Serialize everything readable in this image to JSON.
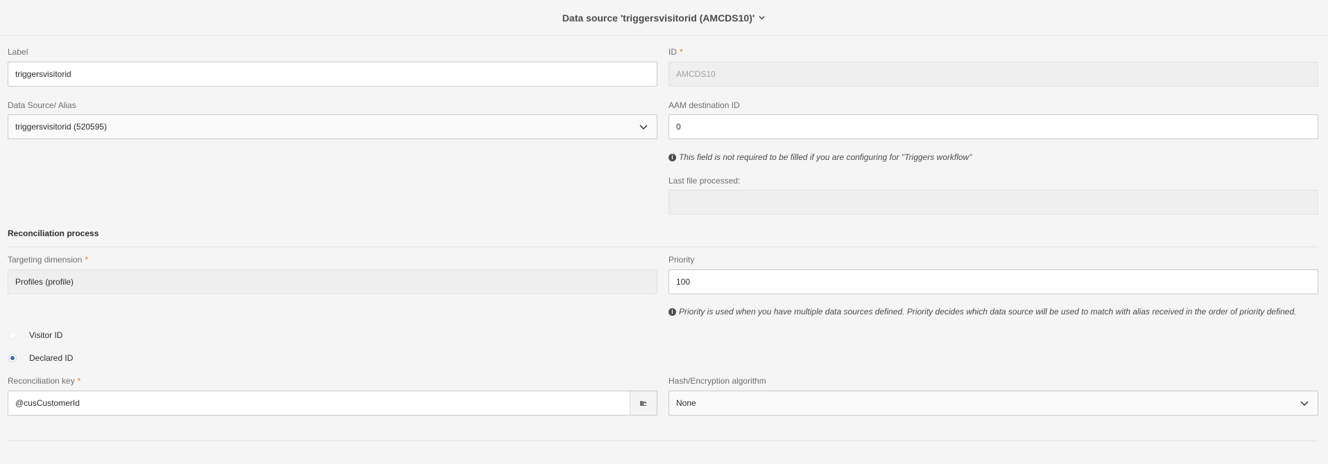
{
  "header": {
    "title": "Data source 'triggersvisitorid (AMCDS10)'"
  },
  "label_field": {
    "label": "Label",
    "value": "triggersvisitorid"
  },
  "id_field": {
    "label": "ID",
    "required_mark": "*",
    "value": "AMCDS10"
  },
  "alias_field": {
    "label": "Data Source/ Alias",
    "value": "triggersvisitorid (520595)"
  },
  "aam_field": {
    "label": "AAM destination ID",
    "value": "0",
    "help": "This field is not required to be filled if you are configuring for \"Triggers workflow\""
  },
  "last_file": {
    "label": "Last file processed:",
    "value": ""
  },
  "reconciliation": {
    "title": "Reconciliation process"
  },
  "targeting": {
    "label": "Targeting dimension",
    "required_mark": "*",
    "value": "Profiles (profile)"
  },
  "priority": {
    "label": "Priority",
    "value": "100",
    "help": "Priority is used when you have multiple data sources defined. Priority decides which data source will be used to match with alias received in the order of priority defined."
  },
  "radios": [
    {
      "label": "Visitor ID",
      "checked": false
    },
    {
      "label": "Declared ID",
      "checked": true
    }
  ],
  "recon_key": {
    "label": "Reconciliation key",
    "required_mark": "*",
    "value": "@cusCustomerId"
  },
  "hash": {
    "label": "Hash/Encryption algorithm",
    "value": "None"
  },
  "icons": {
    "header_chevron": "chevron-down-icon",
    "select_chevron": "chevron-down-icon",
    "info": "info-icon",
    "key_picker": "folder-picker-icon"
  },
  "colors": {
    "accent": "#2d6ec9",
    "required": "#e68619",
    "background": "#f5f5f5"
  }
}
